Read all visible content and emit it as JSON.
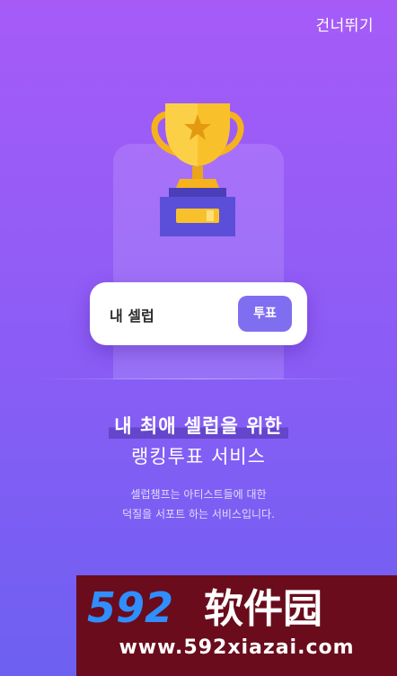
{
  "header": {
    "skip_label": "건너뛰기"
  },
  "icons": {
    "trophy": "trophy-icon"
  },
  "vote_card": {
    "label": "내 셀럽",
    "button_label": "투표"
  },
  "intro": {
    "headline_line1": "내 최애 셀럽을 위한",
    "headline_line2": "랭킹투표 서비스",
    "description_line1": "셀럽챔프는 아티스트들에 대한",
    "description_line2": "덕질을 서포트 하는 서비스입니다."
  },
  "watermark": {
    "logo_text": "592软件园",
    "url": "www.592xiazai.com"
  },
  "colors": {
    "background_top": "#a65bf7",
    "background_bottom": "#6d60f1",
    "vote_button": "#7f6ef0",
    "trophy_gold": "#f8c12b",
    "trophy_base": "#5b4fd9",
    "watermark_bg": "#6a0c1c"
  }
}
